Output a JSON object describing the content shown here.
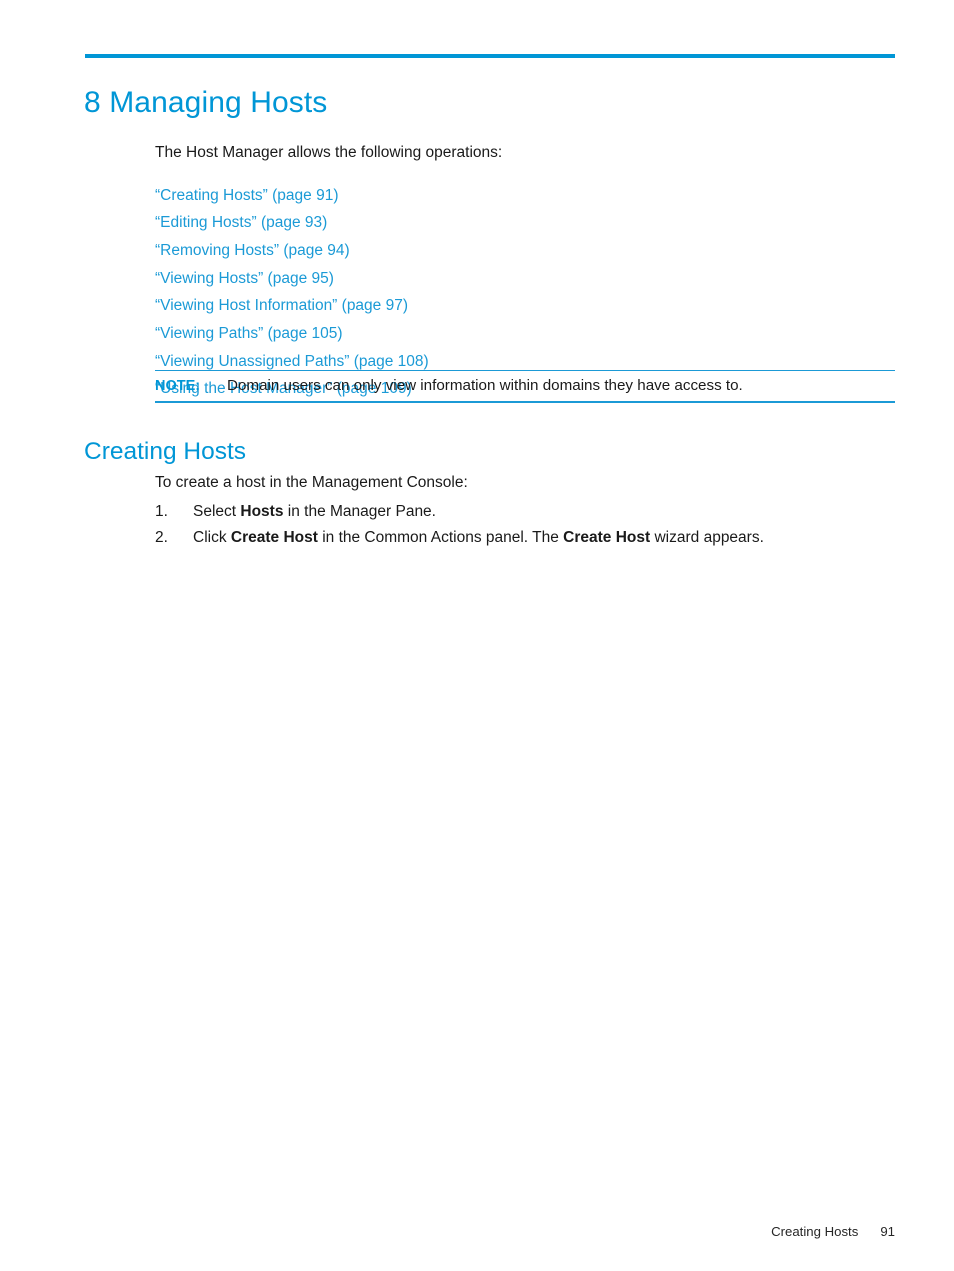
{
  "theme": {
    "accent": "#0096d6",
    "link": "#1b9ad6",
    "text": "#1a1a1a"
  },
  "chapter": {
    "number": "8",
    "title": "8 Managing Hosts"
  },
  "intro": {
    "text": "The Host Manager allows the following operations:"
  },
  "xrefs": [
    {
      "label": "“Creating Hosts” (page 91)"
    },
    {
      "label": "“Editing Hosts” (page 93)"
    },
    {
      "label": "“Removing Hosts” (page 94)"
    },
    {
      "label": "“Viewing Hosts” (page 95)"
    },
    {
      "label": "“Viewing Host Information” (page 97)"
    },
    {
      "label": "“Viewing Paths” (page 105)"
    },
    {
      "label": "“Viewing Unassigned Paths” (page 108)"
    },
    {
      "label": "“Using the Host Manager” (page 109)"
    }
  ],
  "note": {
    "label": "NOTE:",
    "text": "Domain users can only view information within domains they have access to."
  },
  "section": {
    "title": "Creating Hosts",
    "intro": "To create a host in the Management Console:",
    "steps": [
      {
        "number": "1.",
        "pre": "Select ",
        "bold": "Hosts",
        "post": " in the Manager Pane."
      },
      {
        "number": "2.",
        "pre": "Click ",
        "bold": "Create Host",
        "post": " in the Common Actions panel.",
        "sub_pre": "The ",
        "sub_bold": "Create Host",
        "sub_post": " wizard appears."
      }
    ]
  },
  "footer": {
    "section": "Creating Hosts",
    "page": "91"
  }
}
